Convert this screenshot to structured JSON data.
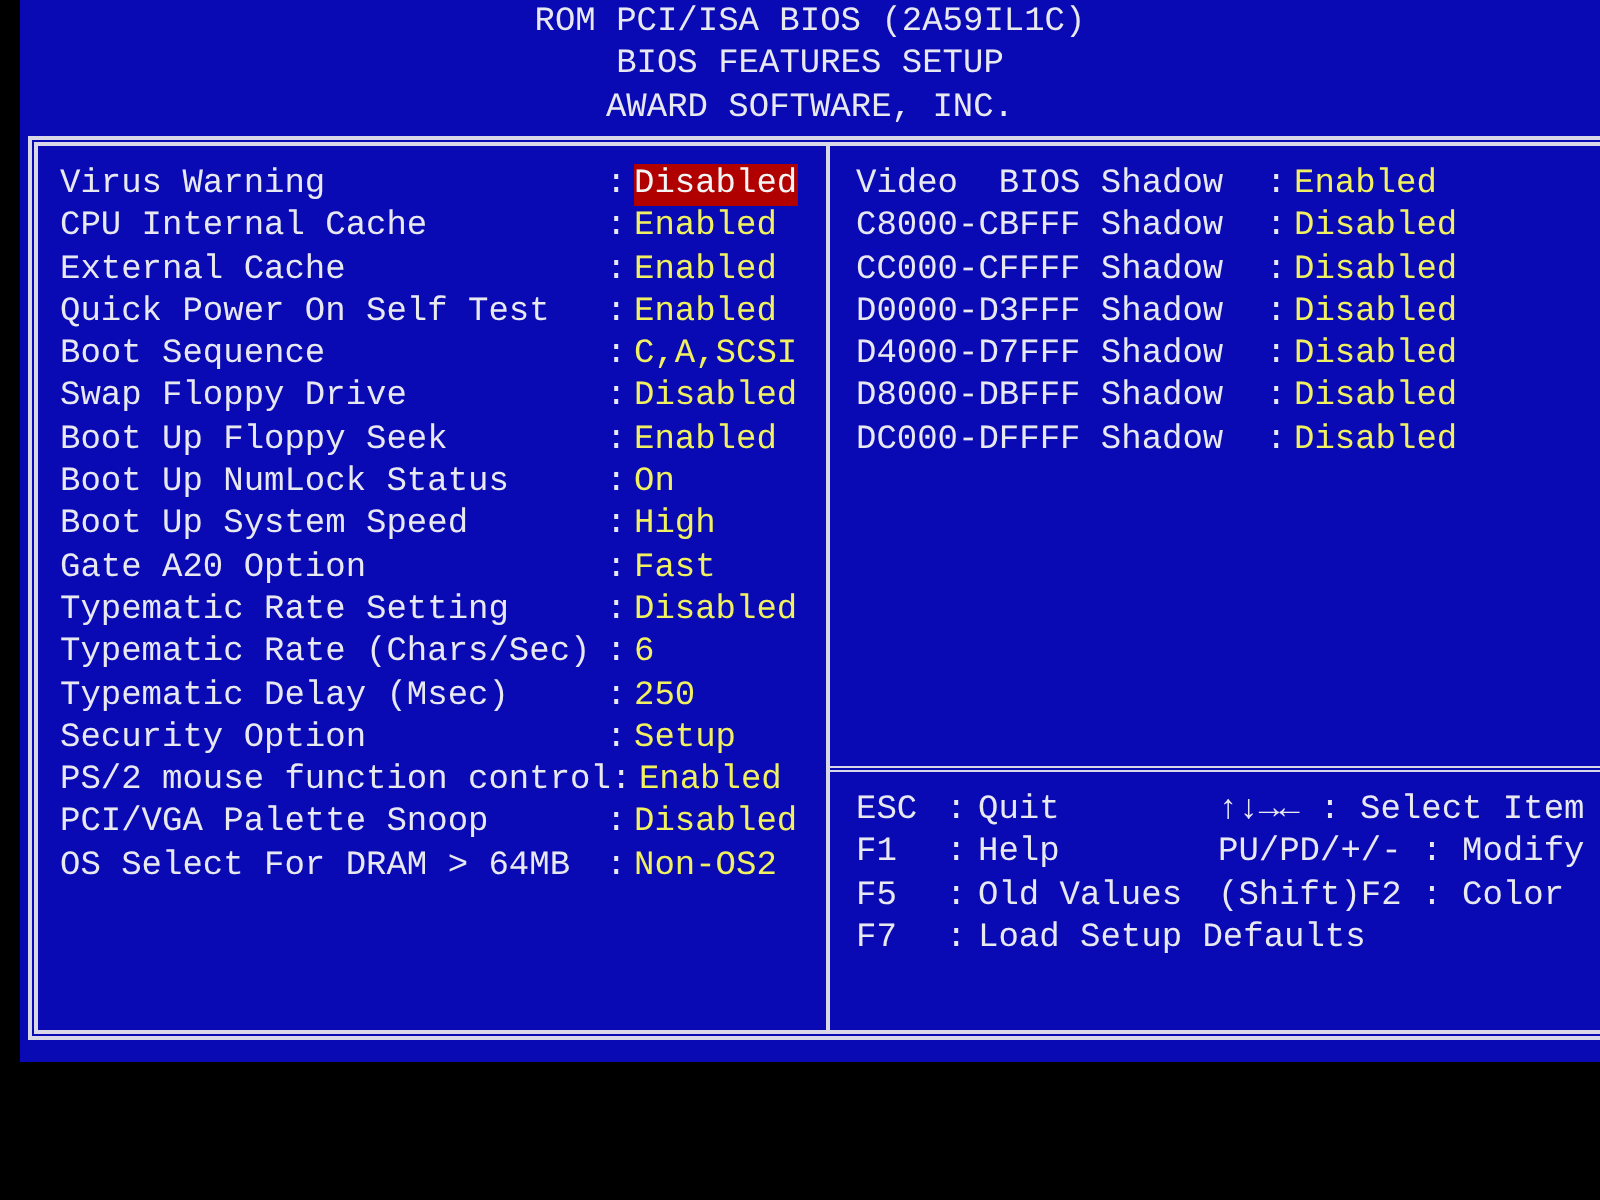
{
  "header": {
    "lines": [
      "ROM PCI/ISA BIOS (2A59IL1C)",
      "BIOS FEATURES SETUP",
      "AWARD SOFTWARE, INC."
    ]
  },
  "settings": [
    {
      "label": "Virus Warning",
      "sep": ":",
      "value": "Disabled",
      "selected": true
    },
    {
      "label": "CPU Internal Cache",
      "sep": ":",
      "value": "Enabled",
      "selected": false
    },
    {
      "label": "External Cache",
      "sep": ":",
      "value": "Enabled",
      "selected": false
    },
    {
      "label": "Quick Power On Self Test",
      "sep": ":",
      "value": "Enabled",
      "selected": false
    },
    {
      "label": "Boot Sequence",
      "sep": ":",
      "value": "C,A,SCSI",
      "selected": false
    },
    {
      "label": "Swap Floppy Drive",
      "sep": ":",
      "value": "Disabled",
      "selected": false
    },
    {
      "label": "Boot Up Floppy Seek",
      "sep": ":",
      "value": "Enabled",
      "selected": false
    },
    {
      "label": "Boot Up NumLock Status",
      "sep": ":",
      "value": "On",
      "selected": false
    },
    {
      "label": "Boot Up System Speed",
      "sep": ":",
      "value": "High",
      "selected": false
    },
    {
      "label": "Gate A20 Option",
      "sep": ":",
      "value": "Fast",
      "selected": false
    },
    {
      "label": "Typematic Rate Setting",
      "sep": ":",
      "value": "Disabled",
      "selected": false
    },
    {
      "label": "Typematic Rate (Chars/Sec)",
      "sep": ":",
      "value": "6",
      "selected": false
    },
    {
      "label": "Typematic Delay (Msec)",
      "sep": ":",
      "value": "250",
      "selected": false
    },
    {
      "label": "Security Option",
      "sep": ":",
      "value": "Setup",
      "selected": false
    },
    {
      "label": "PS/2 mouse function control",
      "sep": ":",
      "value": "Enabled",
      "selected": false
    },
    {
      "label": "PCI/VGA Palette Snoop",
      "sep": ":",
      "value": "Disabled",
      "selected": false
    },
    {
      "label": "OS Select For DRAM > 64MB",
      "sep": ":",
      "value": "Non-OS2",
      "selected": false
    }
  ],
  "shadow_settings": [
    {
      "label": "Video  BIOS Shadow",
      "sep": ":",
      "value": "Enabled",
      "selected": false
    },
    {
      "label": "C8000-CBFFF Shadow",
      "sep": ":",
      "value": "Disabled",
      "selected": false
    },
    {
      "label": "CC000-CFFFF Shadow",
      "sep": ":",
      "value": "Disabled",
      "selected": false
    },
    {
      "label": "D0000-D3FFF Shadow",
      "sep": ":",
      "value": "Disabled",
      "selected": false
    },
    {
      "label": "D4000-D7FFF Shadow",
      "sep": ":",
      "value": "Disabled",
      "selected": false
    },
    {
      "label": "D8000-DBFFF Shadow",
      "sep": ":",
      "value": "Disabled",
      "selected": false
    },
    {
      "label": "DC000-DFFFF Shadow",
      "sep": ":",
      "value": "Disabled",
      "selected": false
    }
  ],
  "help": [
    {
      "key": "ESC",
      "sep": ":",
      "action": "Quit",
      "key2": "↑↓→←",
      "sep2": ":",
      "action2": "Select Item"
    },
    {
      "key": "F1",
      "sep": ":",
      "action": "Help",
      "key2": "PU/PD/+/-",
      "sep2": ":",
      "action2": "Modify"
    },
    {
      "key": "F5",
      "sep": ":",
      "action": "Old Values",
      "key2": "(Shift)F2",
      "sep2": ":",
      "action2": "Color"
    },
    {
      "key": "F7",
      "sep": ":",
      "action": "Load Setup Defaults"
    }
  ]
}
